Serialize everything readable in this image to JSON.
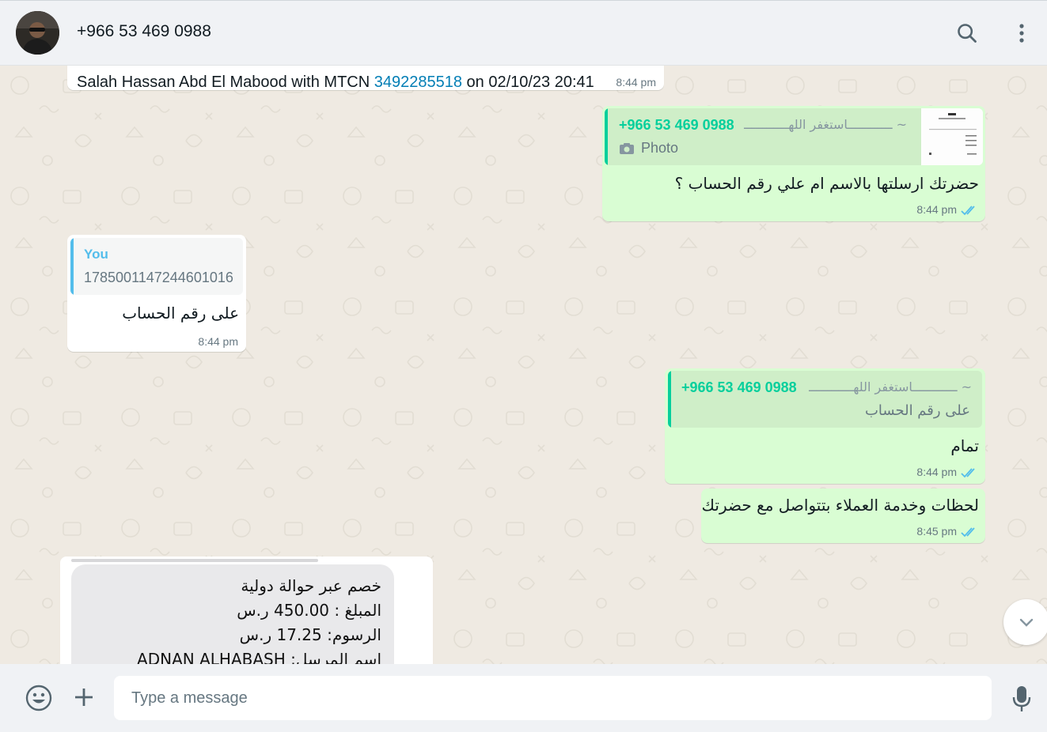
{
  "header": {
    "contact_name": "+966 53 469 0988",
    "search_icon": "search-icon",
    "menu_icon": "kebab-menu-icon"
  },
  "messages": {
    "m1": {
      "text_prefix": "Salah Hassan Abd El Mabood with MTCN ",
      "link": "3492285518",
      "text_suffix": " on 02/10/23 20:41",
      "time": "8:44 pm"
    },
    "m2": {
      "quote_author": "+966 53 469 0988",
      "quote_pushname": "~ ــــــــــــاستغفر اللهــــــــــــ",
      "quote_media": "Photo",
      "text": "حضرتك ارسلتها بالاسم ام علي رقم الحساب ؟",
      "time": "8:44 pm",
      "status": "read"
    },
    "m3": {
      "quote_author": "You",
      "quote_text": "1785001147244601016",
      "text": "على رقم الحساب",
      "time": "8:44 pm"
    },
    "m4": {
      "quote_author": "+966 53 469 0988",
      "quote_pushname": "~ ــــــــــــاستغفر اللهــــــــــــ",
      "quote_text": "على رقم الحساب",
      "text": "تمام",
      "time": "8:44 pm",
      "status": "read"
    },
    "m5": {
      "text": "لحظات وخدمة العملاء بتتواصل مع حضرتك",
      "time": "8:45 pm",
      "status": "read"
    },
    "m6": {
      "lines": [
        "خصم عبر حوالة دولية",
        "المبلغ : 450.00 ر.س",
        "الرسوم: 17.25 ر.س",
        "اسم المرسل: ADNAN ALHABASH"
      ]
    }
  },
  "composer": {
    "placeholder": "Type a message",
    "emoji_icon": "emoji-icon",
    "attach_icon": "plus-icon",
    "mic_icon": "microphone-icon"
  },
  "colors": {
    "incoming_bubble": "#ffffff",
    "outgoing_bubble": "#d9fdd3",
    "link": "#027eb5",
    "quote_green": "#06cf9c",
    "quote_blue": "#53bdeb",
    "read_ticks": "#53bdeb"
  }
}
